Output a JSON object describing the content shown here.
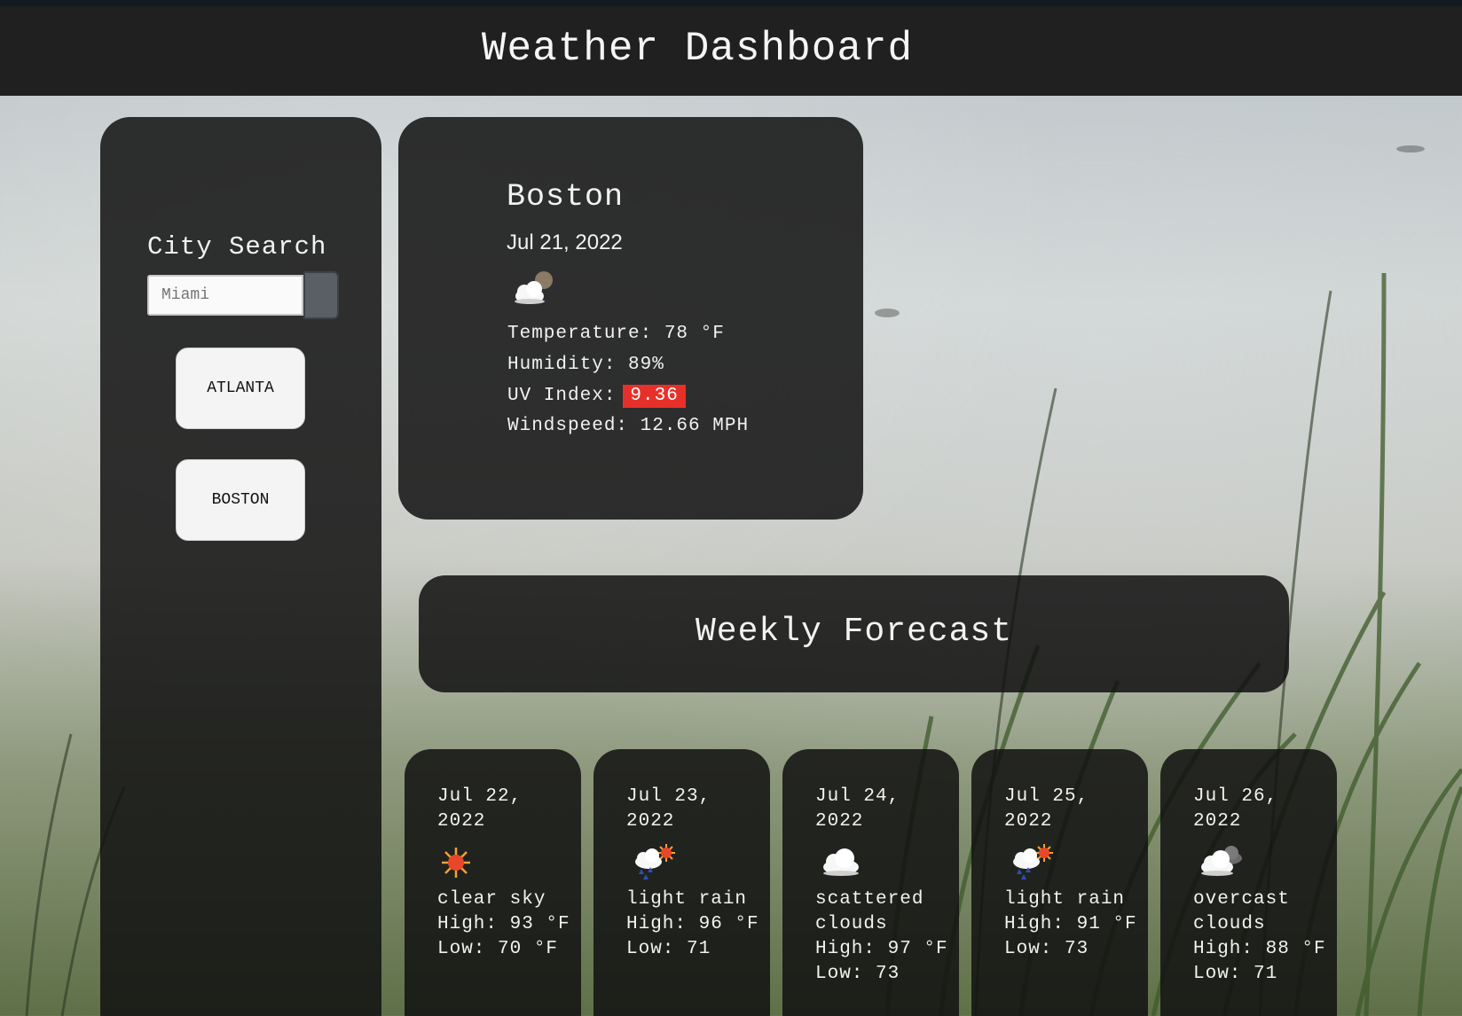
{
  "header": {
    "title": "Weather Dashboard"
  },
  "sidebar": {
    "search_label": "City Search",
    "search_placeholder": "Miami",
    "history": [
      {
        "label": "ATLANTA"
      },
      {
        "label": "BOSTON"
      }
    ]
  },
  "current": {
    "city": "Boston",
    "date": "Jul 21, 2022",
    "icon": "partly-cloudy-night-icon",
    "temperature_label": "Temperature: 78 °F",
    "humidity_label": "Humidity: 89%",
    "uv_label": "UV Index:",
    "uv_value": "9.36",
    "uv_color": "#e8302a",
    "windspeed_label": "Windspeed: 12.66 MPH"
  },
  "weekly": {
    "title": "Weekly Forecast",
    "days": [
      {
        "date": "Jul 22, 2022",
        "icon": "sun-icon",
        "description": "clear sky",
        "high": "High: 93 °F",
        "low": "Low: 70 °F"
      },
      {
        "date": "Jul 23, 2022",
        "icon": "sun-rain-cloud-icon",
        "description": "light rain",
        "high": "High: 96 °F",
        "low": "Low: 71"
      },
      {
        "date": "Jul 24, 2022",
        "icon": "cloud-icon",
        "description": "scattered clouds",
        "high": "High: 97 °F",
        "low": "Low: 73"
      },
      {
        "date": "Jul 25, 2022",
        "icon": "sun-rain-cloud-icon",
        "description": "light rain",
        "high": "High: 91 °F",
        "low": "Low: 73"
      },
      {
        "date": "Jul 26, 2022",
        "icon": "overcast-clouds-icon",
        "description": "overcast clouds",
        "high": "High: 88 °F",
        "low": "Low: 71"
      }
    ]
  }
}
